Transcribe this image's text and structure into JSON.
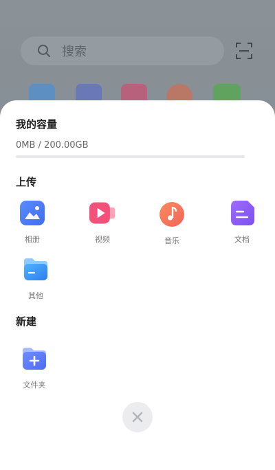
{
  "background": {
    "search_placeholder": "搜索"
  },
  "sheet": {
    "capacity": {
      "title": "我的容量",
      "usage_text": "0MB / 200.00GB",
      "used_fraction": 0.0
    },
    "upload": {
      "title": "上传",
      "items": [
        {
          "label": "相册",
          "icon": "photo-album-icon"
        },
        {
          "label": "视频",
          "icon": "video-icon"
        },
        {
          "label": "音乐",
          "icon": "music-icon"
        },
        {
          "label": "文档",
          "icon": "document-icon"
        },
        {
          "label": "其他",
          "icon": "other-folder-icon"
        }
      ]
    },
    "create": {
      "title": "新建",
      "items": [
        {
          "label": "文件夹",
          "icon": "new-folder-icon"
        }
      ]
    },
    "close_icon": "close-icon"
  },
  "colors": {
    "accent_blue": "#3b82f6",
    "video_pink": "#f3507a",
    "music_orange": "#f97852",
    "doc_purple": "#8b5cf6"
  }
}
